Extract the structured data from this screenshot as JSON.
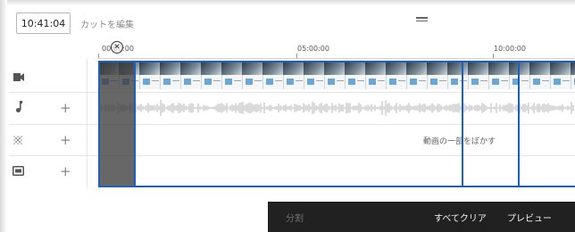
{
  "toolbar": {
    "current_time": "10:41:04",
    "edit_cut_label": "カットを編集"
  },
  "ruler": {
    "ticks": [
      "00:00:00",
      "05:00:00",
      "10:00:00"
    ]
  },
  "tracks": {
    "video": {
      "icon": "video-camera-icon"
    },
    "audio": {
      "icon": "music-note-icon",
      "add": "+"
    },
    "blur": {
      "icon": "blur-icon",
      "add": "+",
      "label": "動画の一部をぼかす"
    },
    "info": {
      "icon": "info-card-icon",
      "add": "+"
    }
  },
  "actions": {
    "split": "分割",
    "clear_all": "すべてクリア",
    "preview": "プレビュー"
  },
  "colors": {
    "selection": "#1c5fbd",
    "action_bar": "#212121",
    "cut_region": "#3c3c3c"
  }
}
